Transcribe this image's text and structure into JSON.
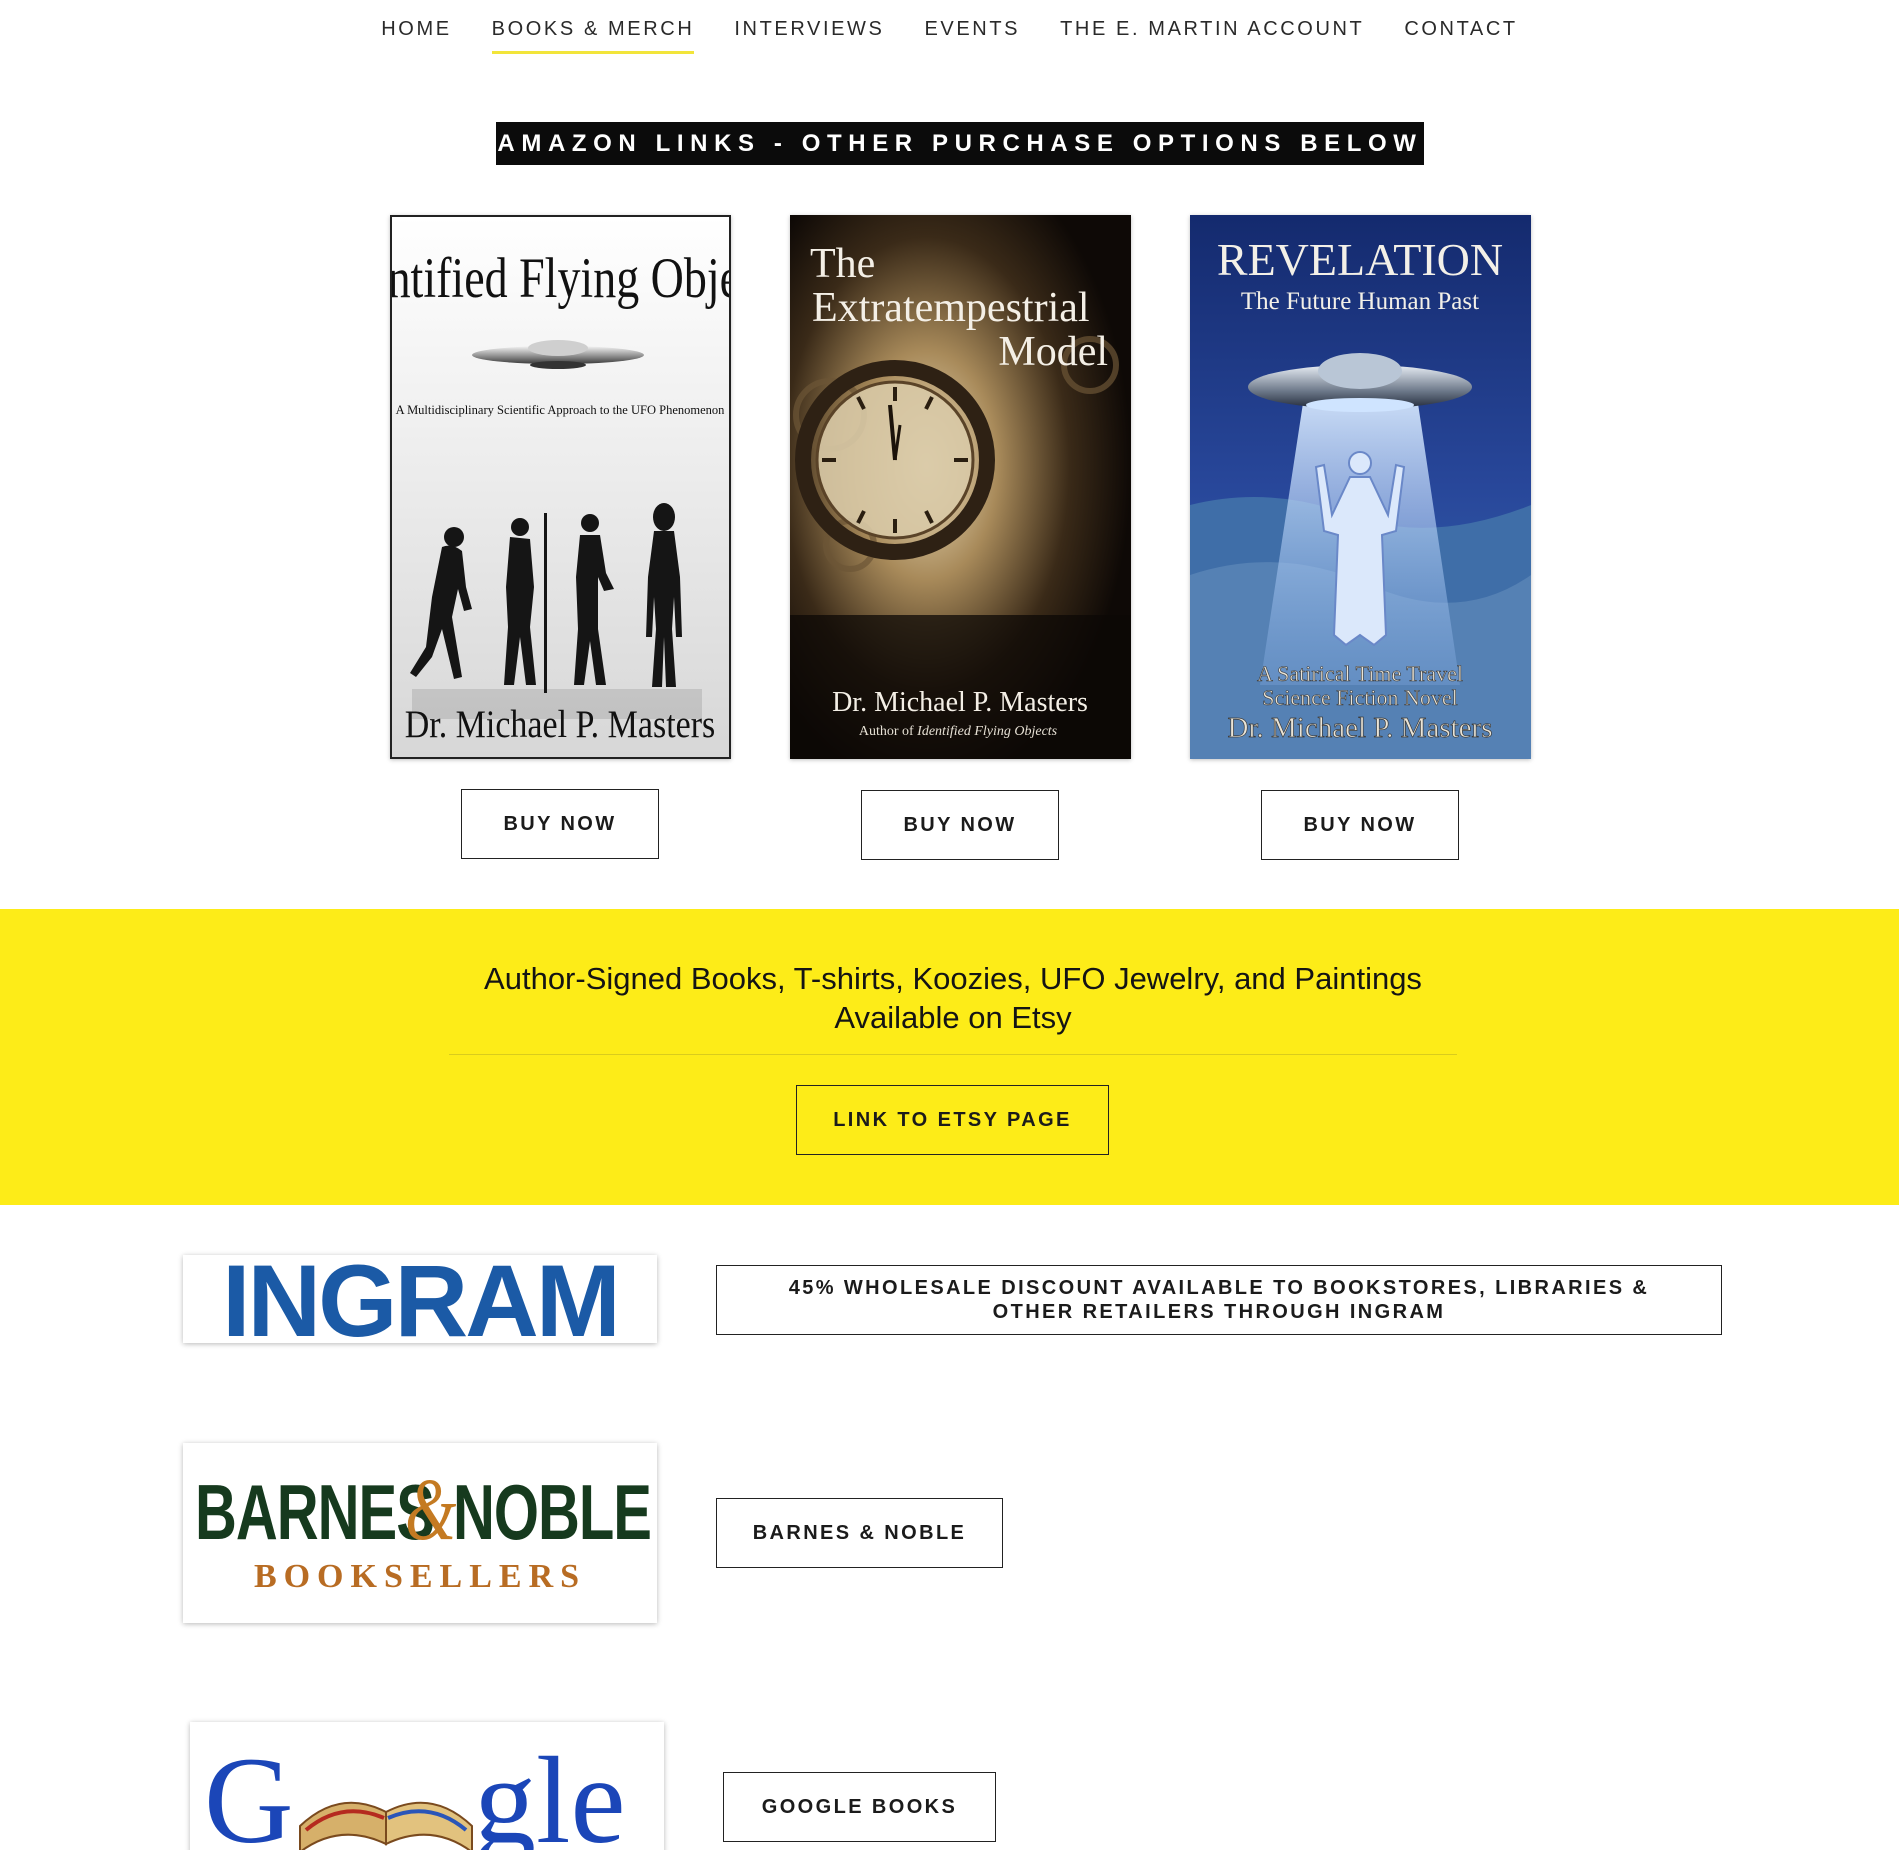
{
  "nav": {
    "items": [
      {
        "label": "HOME",
        "active": false
      },
      {
        "label": "BOOKS & MERCH",
        "active": true
      },
      {
        "label": "INTERVIEWS",
        "active": false
      },
      {
        "label": "EVENTS",
        "active": false
      },
      {
        "label": "THE E. MARTIN ACCOUNT",
        "active": false
      },
      {
        "label": "CONTACT",
        "active": false
      }
    ],
    "active_underline_color": "#f2e53a"
  },
  "amazon_banner": "AMAZON LINKS - OTHER PURCHASE OPTIONS BELOW",
  "books": [
    {
      "cover_title": "Identified Flying Objects",
      "cover_subtitle": "A Multidisciplinary Scientific Approach to the UFO Phenomenon",
      "cover_author": "Dr. Michael P. Masters",
      "buy_label": "BUY NOW"
    },
    {
      "cover_title_line1": "The",
      "cover_title_line2": "Extratempestrial",
      "cover_title_line3": "Model",
      "cover_author": "Dr. Michael P. Masters",
      "cover_author_note_prefix": "Author of ",
      "cover_author_note_title": "Identified Flying Objects",
      "buy_label": "BUY NOW"
    },
    {
      "cover_title": "REVELATION",
      "cover_subtitle": "The Future Human Past",
      "cover_tagline_line1": "A Satirical Time Travel",
      "cover_tagline_line2": "Science Fiction Novel",
      "cover_author": "Dr. Michael P. Masters",
      "buy_label": "BUY NOW"
    }
  ],
  "etsy": {
    "heading": "Author-Signed Books, T-shirts, Koozies, UFO Jewelry, and Paintings Available on Etsy",
    "button": "LINK TO ETSY PAGE",
    "band_color": "#fdec18"
  },
  "retailers": {
    "ingram": {
      "logo_text": "INGRAM",
      "button": "45% WHOLESALE DISCOUNT AVAILABLE TO BOOKSTORES, LIBRARIES & OTHER RETAILERS THROUGH INGRAM"
    },
    "barnes_noble": {
      "logo_text_1": "BARNES",
      "logo_amp": "&",
      "logo_text_2": "NOBLE",
      "logo_sub": "BOOKSELLERS",
      "button": "BARNES & NOBLE"
    },
    "google": {
      "logo_text_1": "G",
      "logo_text_2": "gle",
      "button": "GOOGLE BOOKS"
    }
  }
}
